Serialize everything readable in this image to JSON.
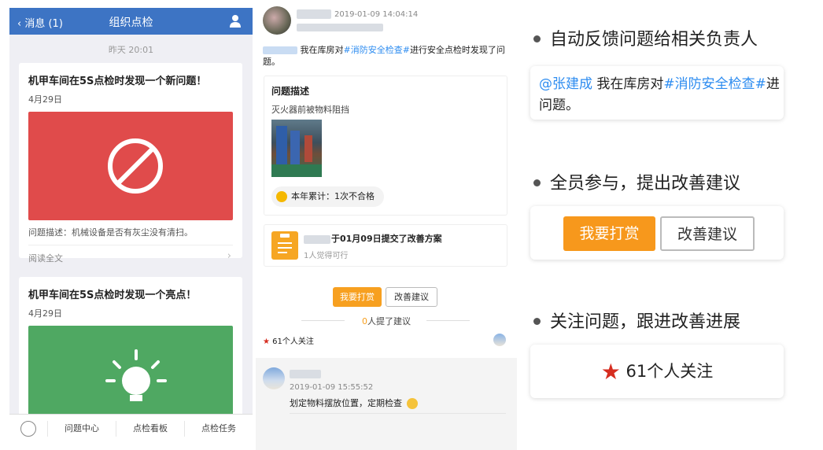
{
  "panel1": {
    "back_label": "消息 (1)",
    "title": "组织点检",
    "time": "昨天 20:01",
    "cards": [
      {
        "title": "机甲车间在5S点检时发现一个新问题！",
        "date": "4月29日",
        "description": "问题描述：机械设备是否有灰尘没有清扫。",
        "read_more": "阅读全文",
        "color": "#e04b4b",
        "icon": "prohibited-icon"
      },
      {
        "title": "机甲车间在5S点检时发现一个亮点！",
        "date": "4月29日",
        "color": "#4fa862",
        "icon": "lightbulb-icon"
      }
    ],
    "tabs": [
      "问题中心",
      "点检看板",
      "点检任务"
    ]
  },
  "panel2": {
    "timestamp": "2019-01-09 14:04:14",
    "post_text_a": " 我在库房对",
    "post_tag": "#消防安全检查#",
    "post_text_b": "进行安全点检时发现了问题。",
    "problem_title": "问题描述",
    "problem_desc": "灭火器前被物料阻挡",
    "yearly_stat": "本年累计：1次不合格",
    "suggestion_title": "于01月09日提交了改善方案",
    "suggestion_sub": "1人觉得可行",
    "reward_button": "我要打赏",
    "improve_button": "改善建议",
    "suggest_count": "0",
    "suggest_text": "人提了建议",
    "follow_text": "61个人关注",
    "comment_time": "2019-01-09 15:55:52",
    "comment_text": "划定物料摆放位置，定期检查"
  },
  "panel3": {
    "bullet1": "自动反馈问题给相关负责人",
    "mention": "@张建成",
    "zoom_text_a": " 我在库房对",
    "zoom_tag": "#消防安全检查#",
    "zoom_tag_tail": "进",
    "zoom_text_b": "问题。",
    "bullet2": "全员参与，提出改善建议",
    "reward_button": "我要打赏",
    "improve_button": "改善建议",
    "bullet3": "关注问题，跟进改善进展",
    "follow_text": "61个人关注"
  },
  "colors": {
    "nav_blue": "#3d74c4",
    "orange": "#f7a020",
    "link": "#2d8cf0",
    "star": "#d62d20"
  }
}
